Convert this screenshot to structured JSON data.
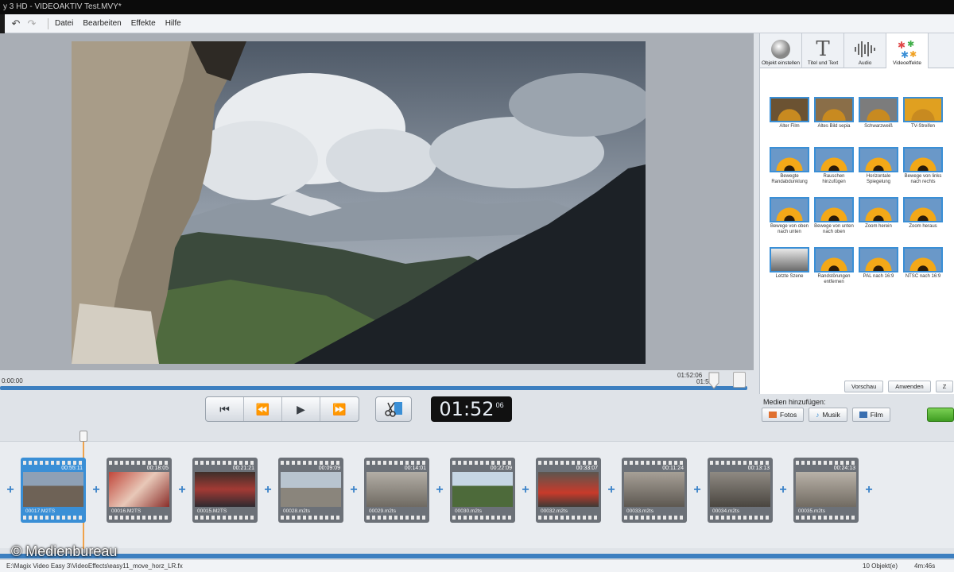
{
  "window": {
    "title": "y 3 HD - VIDEOAKTIV Test.MVY*"
  },
  "menu": {
    "items": [
      "Datei",
      "Bearbeiten",
      "Effekte",
      "Hilfe"
    ]
  },
  "timeline": {
    "start": "0:00:00",
    "current": "01:52:06",
    "current_short": "01:5",
    "progress": 0.955
  },
  "timecode": {
    "main": "01:52",
    "frames": "06"
  },
  "fxpanel": {
    "tabs": [
      {
        "label": "Objekt einstellen",
        "icon": "sphere-icon"
      },
      {
        "label": "Titel und Text",
        "icon": "text-t-icon"
      },
      {
        "label": "Audio",
        "icon": "audio-wave-icon"
      },
      {
        "label": "Videoeffekte",
        "icon": "stars-icon"
      }
    ],
    "effects": [
      "Alter Film",
      "Altes Bild sepia",
      "Schwarzweiß",
      "TV-Streifen",
      "Bewegte Randabdunklung",
      "Rauschen hinzufügen",
      "Horizontale Spiegelung",
      "Bewege von links nach rechts",
      "Bewege von oben nach unten",
      "Bewege von unten nach oben",
      "Zoom herein",
      "Zoom heraus",
      "Letzte Szene",
      "Randstörungen entfernen",
      "PAL nach 16:9",
      "NTSC nach 16:9"
    ],
    "buttons": [
      "Vorschau",
      "Anwenden",
      "Z"
    ]
  },
  "media": {
    "label": "Medien hinzufügen:",
    "buttons": [
      "Fotos",
      "Musik",
      "Film"
    ]
  },
  "clips": [
    {
      "name": "00017.M2TS",
      "duration": "00:55:11",
      "active": true
    },
    {
      "name": "00016.M2TS",
      "duration": "00:18:05",
      "active": false
    },
    {
      "name": "00015.M2TS",
      "duration": "00:21:21",
      "active": false
    },
    {
      "name": "00028.m2ts",
      "duration": "00:09:09",
      "active": false
    },
    {
      "name": "00029.m2ts",
      "duration": "00:14:01",
      "active": false
    },
    {
      "name": "00030.m2ts",
      "duration": "00:22:09",
      "active": false
    },
    {
      "name": "00032.m2ts",
      "duration": "00:33:07",
      "active": false
    },
    {
      "name": "00033.m2ts",
      "duration": "00:11:24",
      "active": false
    },
    {
      "name": "00034.m2ts",
      "duration": "00:13:13",
      "active": false
    },
    {
      "name": "00035.m2ts",
      "duration": "00:24:13",
      "active": false
    }
  ],
  "status": {
    "path": "E:\\Magix Video Easy 3\\VideoEffects\\easy11_move_horz_LR.fx",
    "objects": "10 Objekt(e)",
    "duration": "4m:46s"
  },
  "watermark": "© Medienbureau",
  "colors": {
    "accent": "#3a8fd6",
    "track": "#3c7fc0",
    "playhead": "#f0a24a"
  }
}
